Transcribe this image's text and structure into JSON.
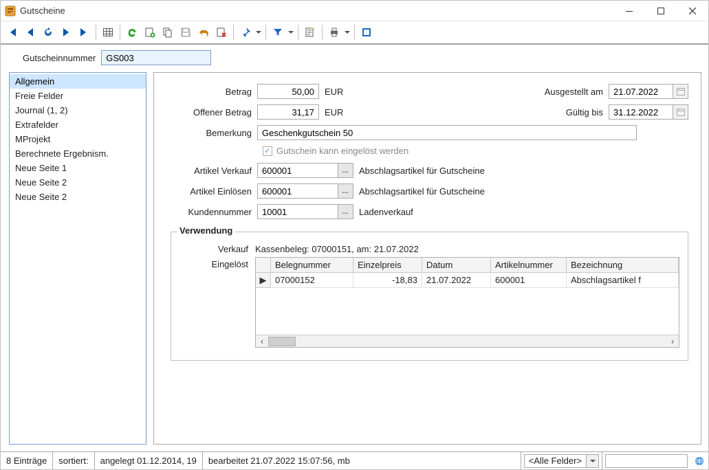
{
  "window": {
    "title": "Gutscheine"
  },
  "header": {
    "label": "Gutscheinnummer",
    "value": "GS003"
  },
  "sidebar": {
    "items": [
      "Allgemein",
      "Freie Felder",
      "Journal (1, 2)",
      "Extrafelder",
      "MProjekt",
      "Berechnete Ergebnism.",
      "Neue Seite 1",
      "Neue Seite 2",
      "Neue Seite 2"
    ],
    "active_index": 0
  },
  "form": {
    "betrag_label": "Betrag",
    "betrag_value": "50,00",
    "betrag_currency": "EUR",
    "ausgestellt_label": "Ausgestellt am",
    "ausgestellt_value": "21.07.2022",
    "offener_label": "Offener Betrag",
    "offener_value": "31,17",
    "offener_currency": "EUR",
    "gueltig_label": "Gültig bis",
    "gueltig_value": "31.12.2022",
    "bemerkung_label": "Bemerkung",
    "bemerkung_value": "Geschenkgutschein 50",
    "checkbox_label": "Gutschein kann eingelöst werden",
    "checkbox_checked": true,
    "artikel_verkauf_label": "Artikel Verkauf",
    "artikel_verkauf_value": "600001",
    "artikel_verkauf_desc": "Abschlagsartikel für Gutscheine",
    "artikel_einloesen_label": "Artikel Einlösen",
    "artikel_einloesen_value": "600001",
    "artikel_einloesen_desc": "Abschlagsartikel für Gutscheine",
    "kunden_label": "Kundennummer",
    "kunden_value": "10001",
    "kunden_desc": "Ladenverkauf"
  },
  "usage": {
    "legend": "Verwendung",
    "verkauf_label": "Verkauf",
    "verkauf_text": "Kassenbeleg: 07000151, am: 21.07.2022",
    "eingeloest_label": "Eingelöst",
    "columns": [
      "Belegnummer",
      "Einzelpreis",
      "Datum",
      "Artikelnummer",
      "Bezeichnung"
    ],
    "rows": [
      {
        "beleg": "07000152",
        "preis": "-18,83",
        "datum": "21.07.2022",
        "artikel": "600001",
        "bez": "Abschlagsartikel f"
      }
    ]
  },
  "status": {
    "count": "8 Einträge",
    "sort_label": "sortiert:",
    "created": "angelegt 01.12.2014, 19",
    "modified": "bearbeitet 21.07.2022 15:07:56, mb",
    "filter_value": "<Alle Felder>"
  }
}
